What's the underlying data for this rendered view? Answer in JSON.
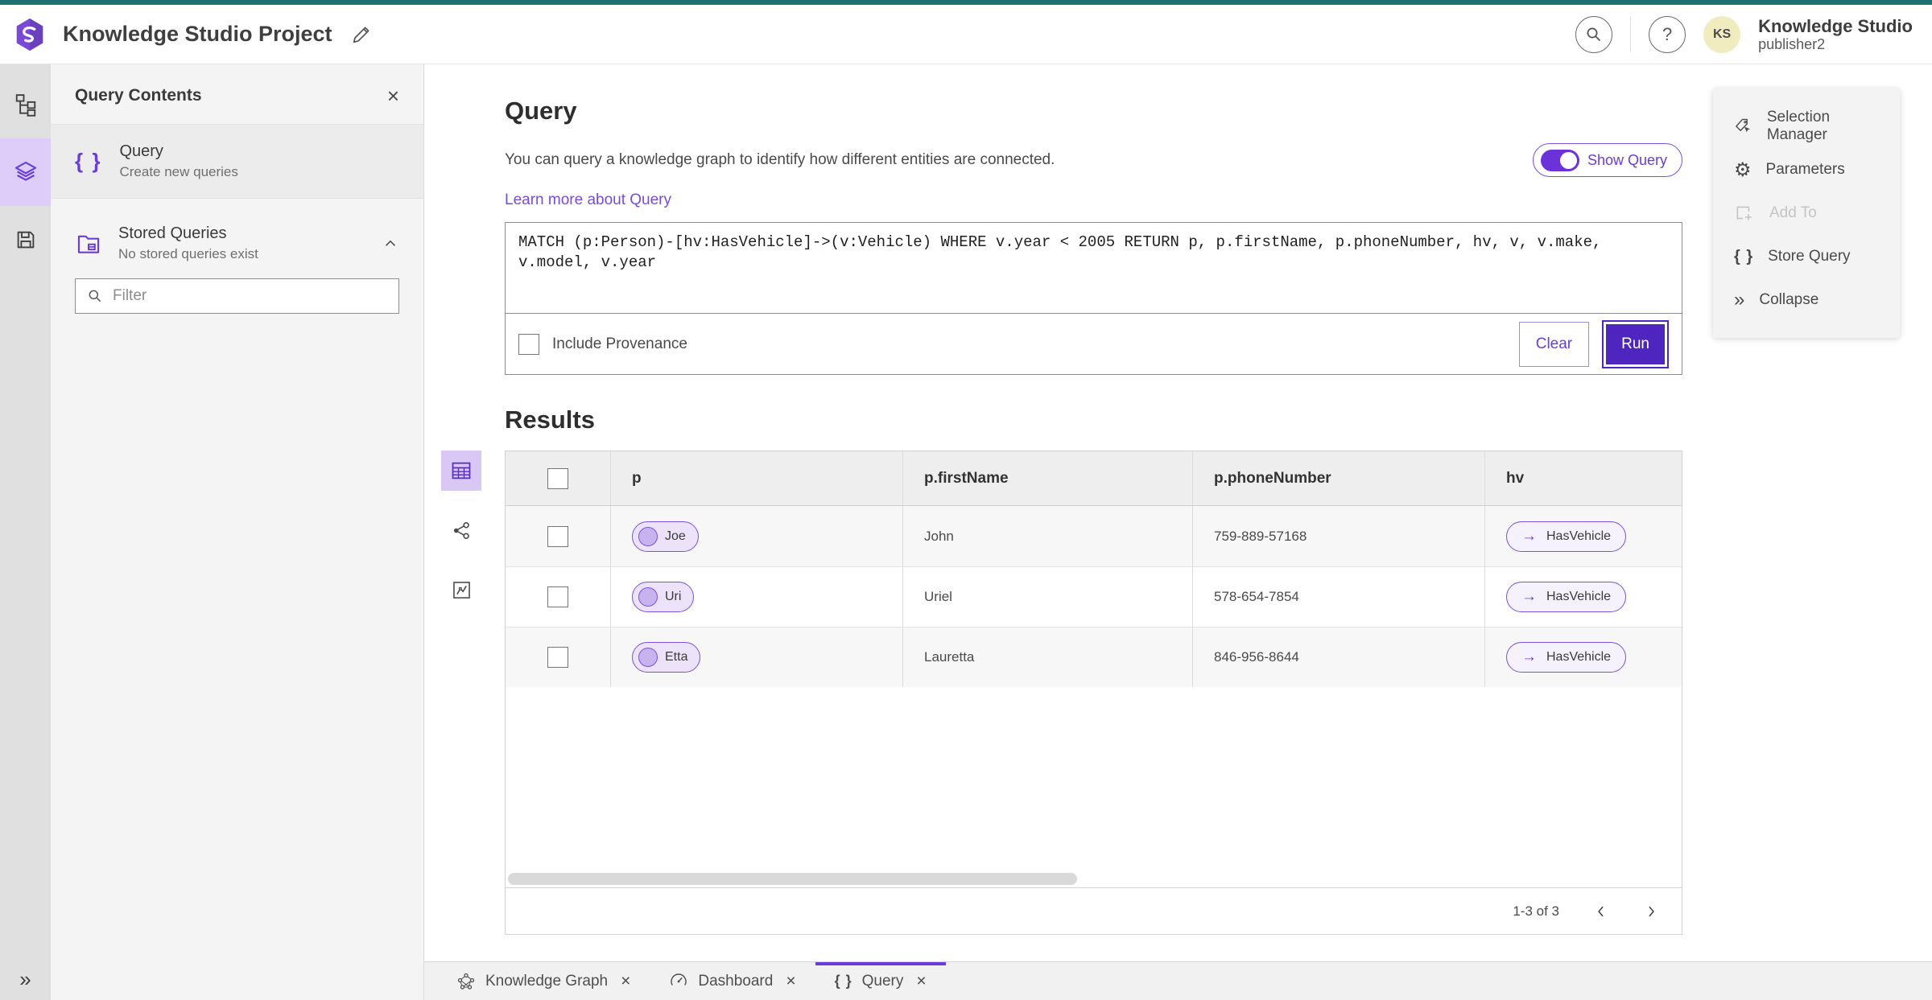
{
  "colors": {
    "brand_teal": "#1d7170",
    "brand_purple": "#6a3dd8",
    "run_button_purple": "#4f25c0",
    "link_purple": "#7a4bdb",
    "selected_light_purple": "#ddcdf8",
    "pill_border_purple": "#7a52dd",
    "avatar_yellow": "#f1ecc0"
  },
  "icons": {
    "close": "×",
    "help": "?",
    "braces": "{ }",
    "arrow_right": "→",
    "collapse_double": "»",
    "gear": "⚙"
  },
  "header": {
    "title": "Knowledge Studio Project",
    "user_initials": "KS",
    "product_name": "Knowledge Studio",
    "user_name": "publisher2"
  },
  "side_panel": {
    "title": "Query Contents",
    "query_item_title": "Query",
    "query_item_subtitle": "Create new queries",
    "stored_title": "Stored Queries",
    "stored_subtitle": "No stored queries exist",
    "filter_placeholder": "Filter"
  },
  "query_section": {
    "heading": "Query",
    "description": "You can query a knowledge graph to identify how different entities are connected.",
    "learn_more": "Learn more about Query",
    "show_query": "Show Query",
    "query_text": "MATCH (p:Person)-[hv:HasVehicle]->(v:Vehicle) WHERE v.year < 2005 RETURN p, p.firstName, p.phoneNumber, hv, v, v.make, v.model, v.year",
    "include_provenance": "Include Provenance",
    "clear": "Clear",
    "run": "Run"
  },
  "actions": {
    "items": [
      {
        "label": "Selection Manager",
        "icon": "selection-manager-icon",
        "disabled": false
      },
      {
        "label": "Parameters",
        "icon": "gear-icon",
        "disabled": false
      },
      {
        "label": "Add To",
        "icon": "add-to-icon",
        "disabled": true
      },
      {
        "label": "Store Query",
        "icon": "braces-icon",
        "disabled": false
      },
      {
        "label": "Collapse",
        "icon": "collapse-icon",
        "disabled": false
      }
    ]
  },
  "results": {
    "heading": "Results",
    "columns": [
      "p",
      "p.firstName",
      "p.phoneNumber",
      "hv"
    ],
    "rows": [
      {
        "p": "Joe",
        "firstName": "John",
        "phone": "759-889-57168",
        "hv": "HasVehicle"
      },
      {
        "p": "Uri",
        "firstName": "Uriel",
        "phone": "578-654-7854",
        "hv": "HasVehicle"
      },
      {
        "p": "Etta",
        "firstName": "Lauretta",
        "phone": "846-956-8644",
        "hv": "HasVehicle"
      }
    ],
    "pagination": "1-3 of 3"
  },
  "tabs": [
    {
      "label": "Knowledge Graph"
    },
    {
      "label": "Dashboard"
    },
    {
      "label": "Query"
    }
  ]
}
